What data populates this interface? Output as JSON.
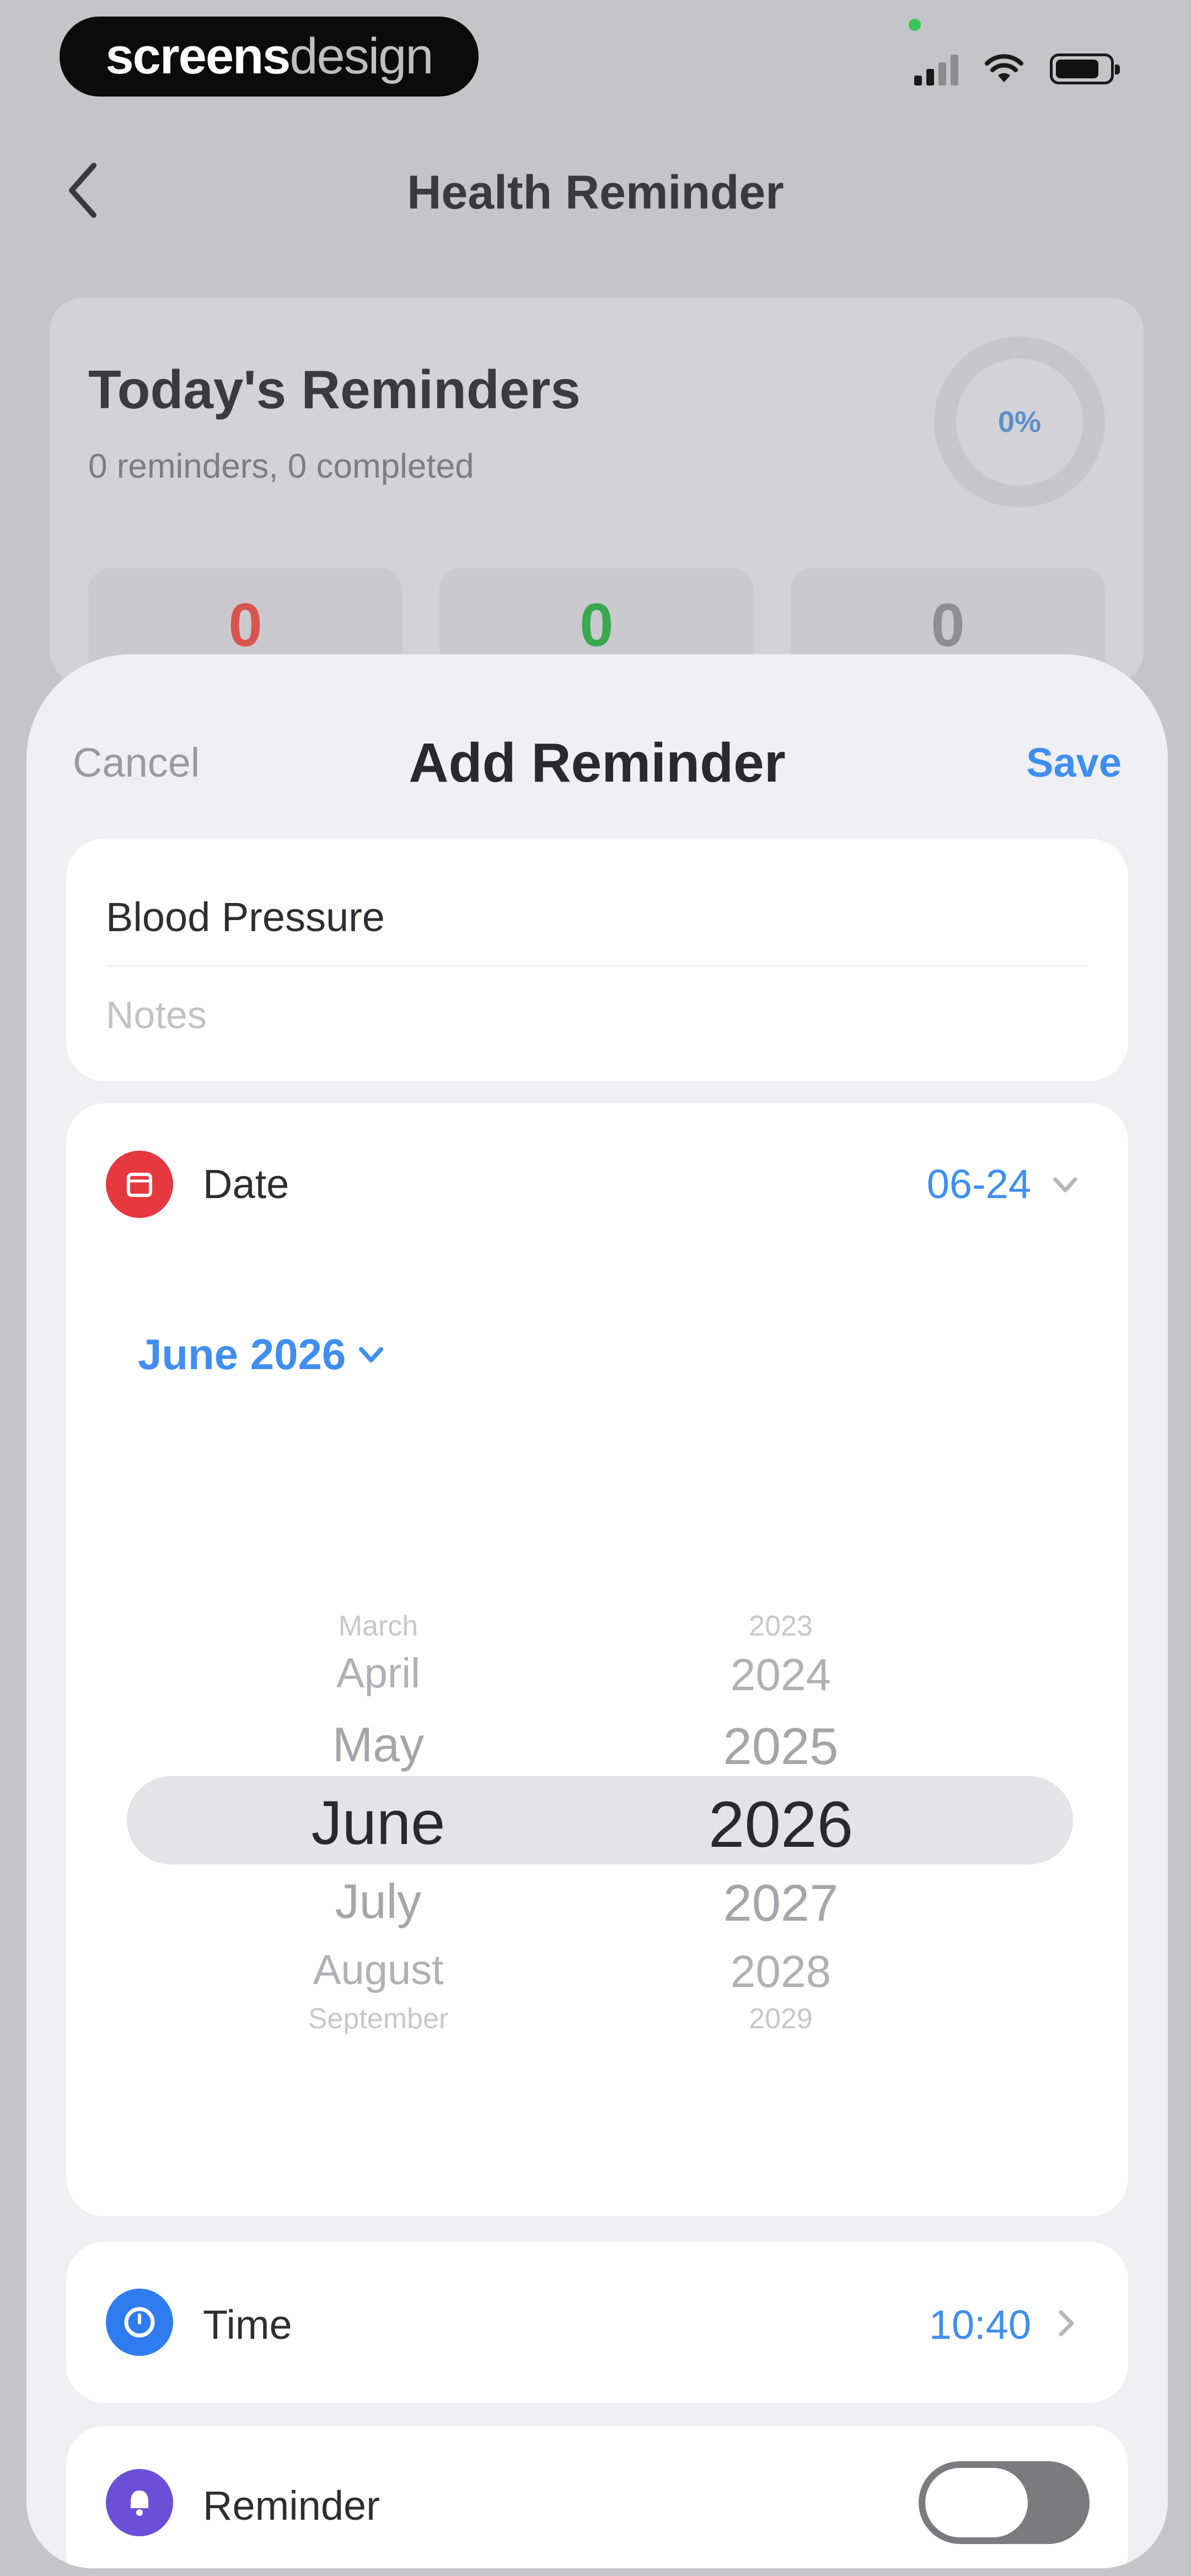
{
  "watermark": {
    "part1": "screens",
    "part2": "design"
  },
  "nav": {
    "title": "Health Reminder"
  },
  "summary": {
    "title": "Today's Reminders",
    "subtitle": "0 reminders, 0 completed",
    "progress": "0%",
    "stats": [
      {
        "value": "0",
        "color": "#d9534f"
      },
      {
        "value": "0",
        "color": "#3aa84f"
      },
      {
        "value": "0",
        "color": "#8e8e93"
      }
    ]
  },
  "sheet": {
    "cancel": "Cancel",
    "title": "Add Reminder",
    "save": "Save",
    "title_value": "Blood Pressure",
    "notes_placeholder": "Notes",
    "date": {
      "label": "Date",
      "value": "06-24",
      "month_year": "June 2026",
      "months": [
        "March",
        "April",
        "May",
        "June",
        "July",
        "August",
        "September"
      ],
      "years": [
        "2023",
        "2024",
        "2025",
        "2026",
        "2027",
        "2028",
        "2029"
      ],
      "selected_month": "June",
      "selected_year": "2026"
    },
    "time": {
      "label": "Time",
      "value": "10:40"
    },
    "reminder": {
      "label": "Reminder",
      "enabled": false
    }
  },
  "colors": {
    "accent": "#3f8ef0",
    "date_icon": "#e5383f",
    "time_icon": "#2f7cf0",
    "reminder_icon": "#6b4fd6"
  }
}
